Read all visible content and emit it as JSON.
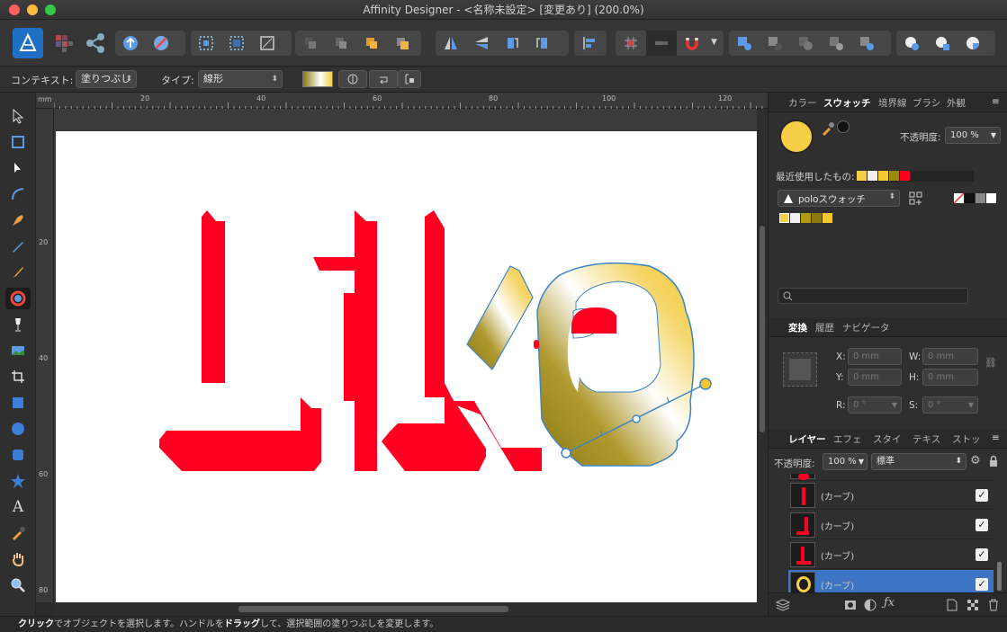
{
  "window": {
    "title": "Affinity Designer - <名称未設定> [変更あり] (200.0%)",
    "traffic_lights": [
      "#fc605c",
      "#fdbc40",
      "#34c84a"
    ]
  },
  "context_bar": {
    "context_label": "コンテキスト:",
    "context_value": "塗りつぶし",
    "type_label": "タイプ:",
    "type_value": "線形"
  },
  "ruler": {
    "top_ticks": [
      "20",
      "40",
      "60",
      "80",
      "100",
      "120"
    ],
    "left_ticks": [
      "20",
      "40",
      "60",
      "80"
    ],
    "unit": "mm"
  },
  "canvas": {
    "artwork_text": "Like",
    "artwork_colors": {
      "red": "#ff0022",
      "gold_dark": "#8a7a10",
      "gold_light": "#f5d040",
      "white": "#ffffff"
    }
  },
  "panel_swatches": {
    "tabs": [
      "カラー",
      "スウォッチ",
      "境界線",
      "ブラシ",
      "外観"
    ],
    "active_tab": "スウォッチ",
    "opacity_label": "不透明度:",
    "opacity_value": "100 %",
    "recent_label": "最近使用したもの:",
    "palette_name": "poloスウォッチ",
    "current_fill_color": "#f5cf45"
  },
  "panel_transform": {
    "tabs": [
      "変換",
      "履歴",
      "ナビゲータ"
    ],
    "active_tab": "変換",
    "x_label": "X:",
    "x_value": "0 mm",
    "y_label": "Y:",
    "y_value": "0 mm",
    "w_label": "W:",
    "w_value": "0 mm",
    "h_label": "H:",
    "h_value": "0 mm",
    "r_label": "R:",
    "r_value": "0 °",
    "s_label": "S:",
    "s_value": "0 °"
  },
  "panel_layers": {
    "tabs": [
      "レイヤー",
      "エフェ",
      "スタイ",
      "テキス",
      "ストッ"
    ],
    "active_tab": "レイヤー",
    "opacity_label": "不透明度:",
    "opacity_value": "100 %",
    "blend_mode": "標準",
    "layers": [
      {
        "name": "(カーブ)",
        "checked": "✓"
      },
      {
        "name": "(カーブ)",
        "checked": "✓"
      },
      {
        "name": "(カーブ)",
        "checked": "✓"
      },
      {
        "name": "(カーブ)",
        "checked": "✓"
      }
    ]
  },
  "status": {
    "bold1": "クリック",
    "text1": "でオブジェクトを選択します。ハンドルを",
    "bold2": "ドラッグ",
    "text2": "して、選択範囲の塗りつぶしを変更します。"
  }
}
